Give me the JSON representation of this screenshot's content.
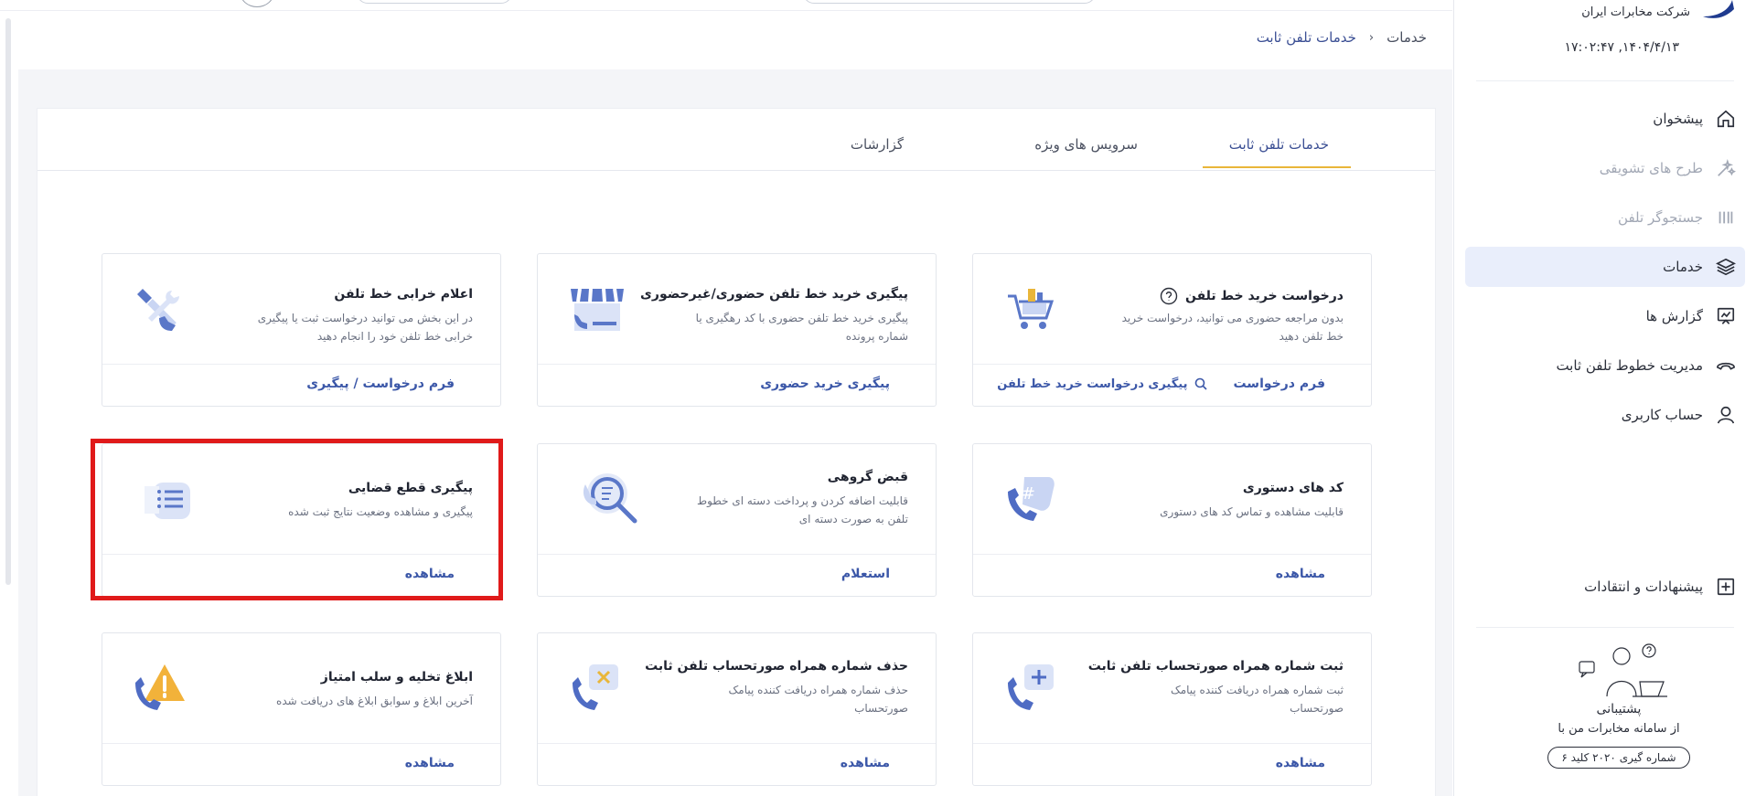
{
  "sidebar": {
    "brand_name": "شرکت مخابرات ایران",
    "datetime": "۱۷:۰۲:۴۷ ,۱۴۰۴/۴/۱۳",
    "nav": [
      {
        "label": "پیشخوان",
        "icon": "home-icon",
        "state": "normal"
      },
      {
        "label": "طرح های تشویقی",
        "icon": "sparkle-icon",
        "state": "disabled"
      },
      {
        "label": "جستجوگر تلفن",
        "icon": "bars-icon",
        "state": "disabled"
      },
      {
        "label": "خدمات",
        "icon": "layers-icon",
        "state": "active"
      },
      {
        "label": "گزارش ها",
        "icon": "report-icon",
        "state": "normal"
      },
      {
        "label": "مدیریت خطوط تلفن ثابت",
        "icon": "phone-line-icon",
        "state": "normal"
      },
      {
        "label": "حساب کاربری",
        "icon": "user-icon",
        "state": "normal"
      }
    ],
    "feedback_label": "پیشنهادات و انتقادات",
    "support": {
      "title": "پشتیبانی",
      "subtitle": "از سامانه مخابرات من با",
      "pill": "شماره گیری ۲۰۲۰ کلید ۶"
    }
  },
  "breadcrumb": {
    "root": "خدمات",
    "current": "خدمات تلفن ثابت"
  },
  "tabs": [
    {
      "label": "خدمات تلفن ثابت",
      "active": true
    },
    {
      "label": "سرویس های ویژه",
      "active": false
    },
    {
      "label": "گزارشات",
      "active": false
    }
  ],
  "cards": [
    {
      "title": "درخواست خرید خط تلفن",
      "desc": "بدون مراجعه حضوری می توانید، درخواست خرید خط تلفن دهید",
      "actions": [
        "فرم درخواست",
        "پیگیری درخواست خرید خط تلفن"
      ],
      "icon": "shopping-cart-icon"
    },
    {
      "title": "پیگیری خرید خط تلفن حضوری/غیرحضوری",
      "desc": "پیگیری خرید خط تلفن حضوری با کد رهگیری یا شماره پرونده",
      "actions": [
        "پیگیری خرید حضوری"
      ],
      "icon": "store-icon"
    },
    {
      "title": "اعلام خرابی خط تلفن",
      "desc": "در این بخش می توانید درخواست ثبت یا پیگیری خرابی خط تلفن خود را انجام دهید",
      "actions": [
        "فرم درخواست / پیگیری"
      ],
      "icon": "repair-tools-icon"
    },
    {
      "title": "کد های دستوری",
      "desc": "قابلیت مشاهده و تماس کد های دستوری",
      "actions": [
        "مشاهده"
      ],
      "icon": "phone-hash-icon"
    },
    {
      "title": "قبض گروهی",
      "desc": "قابلیت اضافه کردن و پرداخت دسته ای خطوط تلفن به صورت دسته ای",
      "actions": [
        "استعلام"
      ],
      "icon": "magnifier-icon"
    },
    {
      "title": "پیگیری قطع قضایی",
      "desc": "پیگیری و مشاهده وضعیت نتایج ثبت شده",
      "actions": [
        "مشاهده"
      ],
      "icon": "list-icon"
    },
    {
      "title": "ثبت شماره همراه صورتحساب تلفن ثابت",
      "desc": "ثبت شماره همراه دریافت کننده پیامک صورتحساب",
      "actions": [
        "مشاهده"
      ],
      "icon": "phone-plus-icon"
    },
    {
      "title": "حذف شماره همراه صورتحساب تلفن ثابت",
      "desc": "حذف شماره همراه دریافت کننده پیامک صورتحساب",
      "actions": [
        "مشاهده"
      ],
      "icon": "phone-remove-icon"
    },
    {
      "title": "ابلاغ تخلیه و سلب امتیاز",
      "desc": "آخرین ابلاغ و سوابق ابلاغ های دریافت شده",
      "actions": [
        "مشاهده"
      ],
      "icon": "warning-phone-icon"
    }
  ],
  "colors": {
    "accent": "#3b57a8",
    "tab_underline": "#e9b63a",
    "highlight": "#e01a1a",
    "active_nav_bg": "#e9eefb"
  }
}
